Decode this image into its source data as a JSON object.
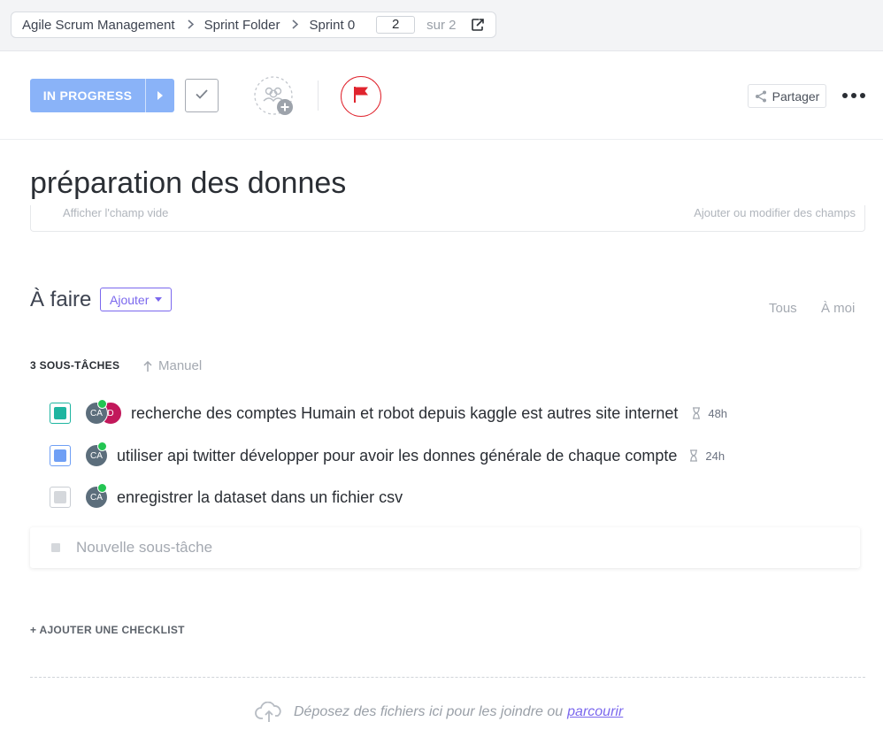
{
  "breadcrumb": {
    "items": [
      "Agile Scrum Management",
      "Sprint Folder",
      "Sprint 0"
    ],
    "page_current": "2",
    "page_total_label": "sur 2"
  },
  "toolbar": {
    "status_label": "IN PROGRESS",
    "status_color": "#8ab3f8",
    "flag_color": "#e0242e",
    "share_label": "Partager"
  },
  "task": {
    "title": "préparation des donnes",
    "fields_hint_left": "Afficher l'champ vide",
    "fields_hint_right": "Ajouter ou modifier des champs"
  },
  "todo": {
    "heading": "À faire",
    "add_label": "Ajouter",
    "filter_all": "Tous",
    "filter_me": "À moi",
    "subtasks_count_label": "3 SOUS-TÂCHES",
    "sort_label": "Manuel",
    "subtasks": [
      {
        "name": "recherche des comptes Humain et robot depuis kaggle est autres site internet",
        "status_color": "#1db5a0",
        "assignees": [
          "CA",
          "D"
        ],
        "estimate": "48h"
      },
      {
        "name": "utiliser api twitter développer pour avoir les donnes générale de chaque compte",
        "status_color": "#6f9ff5",
        "assignees": [
          "CA"
        ],
        "estimate": "24h"
      },
      {
        "name": "enregistrer la dataset dans un fichier csv",
        "status_color": "#d5d8dc",
        "assignees": [
          "CA"
        ],
        "estimate": ""
      }
    ],
    "new_subtask_placeholder": "Nouvelle sous-tâche",
    "add_checklist_label": "+ AJOUTER UNE CHECKLIST"
  },
  "dropzone": {
    "text": "Déposez des fichiers ici pour les joindre ou",
    "link": "parcourir"
  },
  "icons": [
    "chevron-right-icon",
    "exit-icon",
    "caret-right-icon",
    "check-icon",
    "add-assignee-icon",
    "flag-icon",
    "share-icon",
    "more-icon",
    "arrow-up-icon",
    "hourglass-icon",
    "cloud-upload-icon"
  ]
}
